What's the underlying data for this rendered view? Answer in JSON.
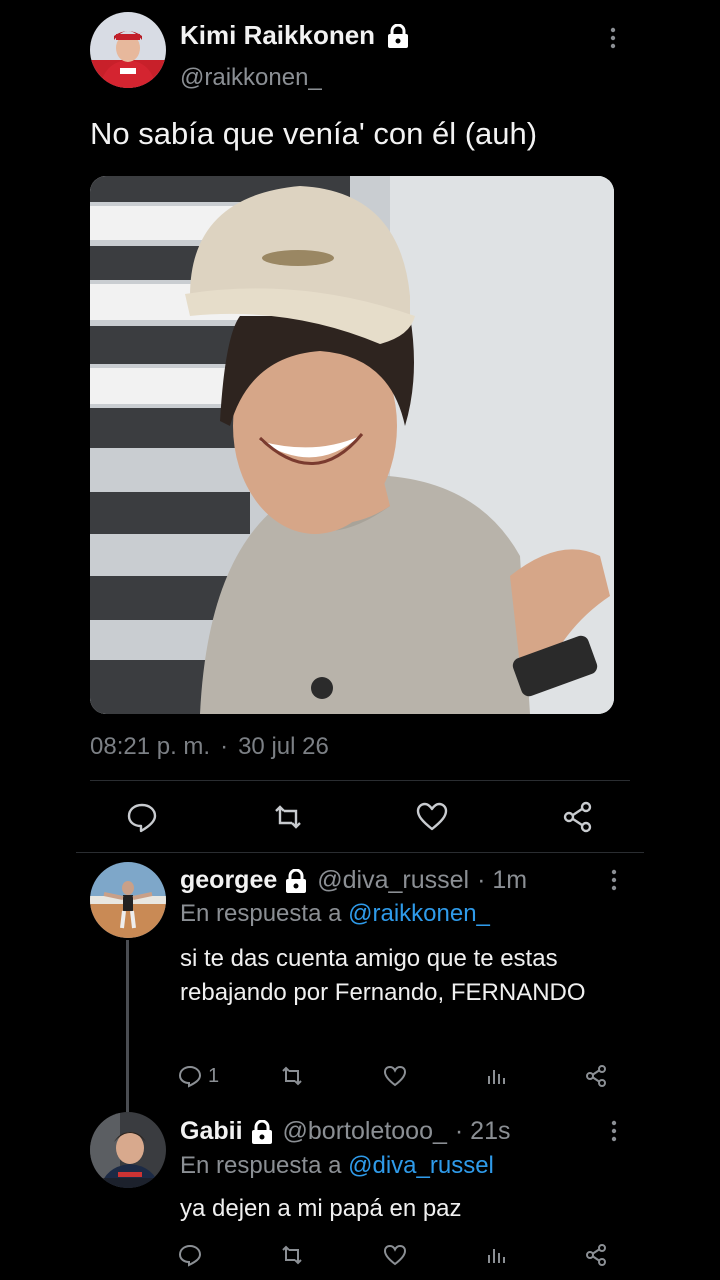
{
  "main_tweet": {
    "author_name": "Kimi Raikkonen",
    "author_handle": "@raikkonen_",
    "text": "No sabía que venía' con él (auh)",
    "time": "08:21 p. m.",
    "separator": "·",
    "date": "30 jul 26",
    "icons": [
      "lock-icon",
      "more-icon",
      "reply-icon",
      "retweet-icon",
      "like-icon",
      "share-icon"
    ]
  },
  "replies": [
    {
      "name": "georgee",
      "handle": "@diva_russel",
      "age": "· 1m",
      "reply_prefix": "En respuesta a",
      "reply_to": "@raikkonen_",
      "text": "si te das cuenta amigo que te estas rebajando por Fernando, FERNANDO",
      "reply_count": "1"
    },
    {
      "name": "Gabii",
      "handle": "@bortoletooo_",
      "age": "· 21s",
      "reply_prefix": "En respuesta a",
      "reply_to": "@diva_russel",
      "text": "ya dejen a mi papá en paz",
      "reply_count": ""
    }
  ],
  "colors": {
    "background": "#000000",
    "mention": "#2f9bea",
    "muted": "#8b8f94"
  }
}
